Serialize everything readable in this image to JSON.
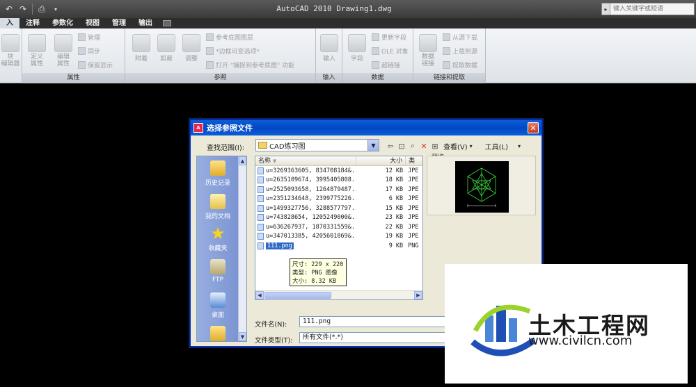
{
  "app": {
    "title": "AutoCAD 2010  Drawing1.dwg",
    "search_placeholder": "键入关键字或短语"
  },
  "ribbon": {
    "tabs": [
      {
        "label": "入",
        "active": true
      },
      {
        "label": "注释"
      },
      {
        "label": "参数化"
      },
      {
        "label": "视图"
      },
      {
        "label": "管理"
      },
      {
        "label": "输出"
      }
    ],
    "panels": {
      "block_editor": {
        "button": "块\n编辑器"
      },
      "attributes": {
        "label": "属性",
        "define": "定义\n属性",
        "edit": "编辑\n属性",
        "manage": "管理",
        "sync": "同步",
        "keep_display": "保留显示"
      },
      "reference": {
        "label": "参照",
        "attach": "附着",
        "clip": "剪裁",
        "adjust": "调整",
        "underlay_layers": "参考底图图层",
        "frames_vary": "*边框可变选项*",
        "snap_underlay": "打开 \"捕捉到参考底图\" 功能"
      },
      "import": {
        "label": "输入",
        "button": "输入"
      },
      "data": {
        "label": "数据",
        "field": "字段",
        "update_fields": "更新字段",
        "ole": "OLE 对象",
        "hyperlink": "超链接"
      },
      "link_extract": {
        "label": "链接和提取",
        "data_link": "数据\n链接",
        "download_source": "从源下载",
        "upload_source": "上载到源",
        "extract_data": "提取数据"
      }
    }
  },
  "dialog": {
    "title": "选择参照文件",
    "look_in_label": "查找范围(I):",
    "look_in_value": "CAD练习图",
    "views_label": "查看(V)",
    "tools_label": "工具(L)",
    "places": [
      {
        "label": "历史记录"
      },
      {
        "label": "我的文档"
      },
      {
        "label": "收藏夹"
      },
      {
        "label": "FTP"
      },
      {
        "label": "桌面"
      }
    ],
    "columns": {
      "name": "名称",
      "size": "大小",
      "type": "类"
    },
    "files": [
      {
        "name": "u=3269363605, 834708184&...",
        "size": "12 KB",
        "type": "JPE"
      },
      {
        "name": "u=2635109674, 3995405808...",
        "size": "18 KB",
        "type": "JPE"
      },
      {
        "name": "u=2525093658, 1264879487...",
        "size": "17 KB",
        "type": "JPE"
      },
      {
        "name": "u=2351234648, 2399775226...",
        "size": "6 KB",
        "type": "JPE"
      },
      {
        "name": "u=1499327756, 3288577797...",
        "size": "15 KB",
        "type": "JPE"
      },
      {
        "name": "u=743828654, 1205249000&...",
        "size": "23 KB",
        "type": "JPE"
      },
      {
        "name": "u=636267937, 1870331559&...",
        "size": "22 KB",
        "type": "JPE"
      },
      {
        "name": "u=347013385, 4205601869&...",
        "size": "19 KB",
        "type": "JPE"
      },
      {
        "name": "111.png",
        "size": "9 KB",
        "type": "PNG",
        "selected": true
      }
    ],
    "tooltip": {
      "dimensions": "尺寸: 229 x 220",
      "type": "类型: PNG 图像",
      "size": "大小: 8.32 KB"
    },
    "preview_label": "预览",
    "filename_label": "文件名(N):",
    "filename_value": "111.png",
    "filetype_label": "文件类型(T):",
    "filetype_value": "所有文件(*.*)"
  },
  "watermark": {
    "name": "土木工程网",
    "url": "www.civilcn.com"
  },
  "colors": {
    "dialog_title_blue": "#0a5fd8",
    "selection_blue": "#316ac5",
    "preview_lines": "#3cdc3c"
  }
}
